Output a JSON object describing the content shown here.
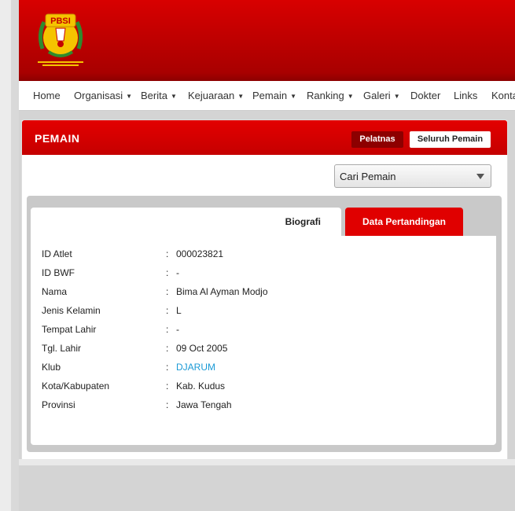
{
  "nav": {
    "items": [
      {
        "label": "Home",
        "dropdown": false
      },
      {
        "label": "Organisasi",
        "dropdown": true
      },
      {
        "label": "Berita",
        "dropdown": true
      },
      {
        "label": "Kejuaraan",
        "dropdown": true
      },
      {
        "label": "Pemain",
        "dropdown": true
      },
      {
        "label": "Ranking",
        "dropdown": true
      },
      {
        "label": "Galeri",
        "dropdown": true
      },
      {
        "label": "Dokter",
        "dropdown": false
      },
      {
        "label": "Links",
        "dropdown": false
      },
      {
        "label": "Konta",
        "dropdown": false
      }
    ]
  },
  "logo": {
    "text": "PBSI"
  },
  "panel": {
    "title": "PEMAIN",
    "btn_pelatnas": "Pelatnas",
    "btn_seluruh": "Seluruh Pemain",
    "search_select": "Cari Pemain"
  },
  "tabs": {
    "biografi": "Biografi",
    "data_pertandingan": "Data Pertandingan"
  },
  "bio": {
    "sep": ":",
    "rows": [
      {
        "label": "ID Atlet",
        "value": "000023821"
      },
      {
        "label": "ID BWF",
        "value": "-"
      },
      {
        "label": "Nama",
        "value": "Bima Al Ayman Modjo"
      },
      {
        "label": "Jenis Kelamin",
        "value": "L"
      },
      {
        "label": "Tempat Lahir",
        "value": "-"
      },
      {
        "label": "Tgl. Lahir",
        "value": "09 Oct 2005"
      },
      {
        "label": "Klub",
        "value": "DJARUM"
      },
      {
        "label": "Kota/Kabupaten",
        "value": "Kab. Kudus"
      },
      {
        "label": "Provinsi",
        "value": "Jawa Tengah"
      }
    ]
  },
  "colors": {
    "brand_red": "#e00000",
    "link_blue": "#1a9ad6"
  }
}
